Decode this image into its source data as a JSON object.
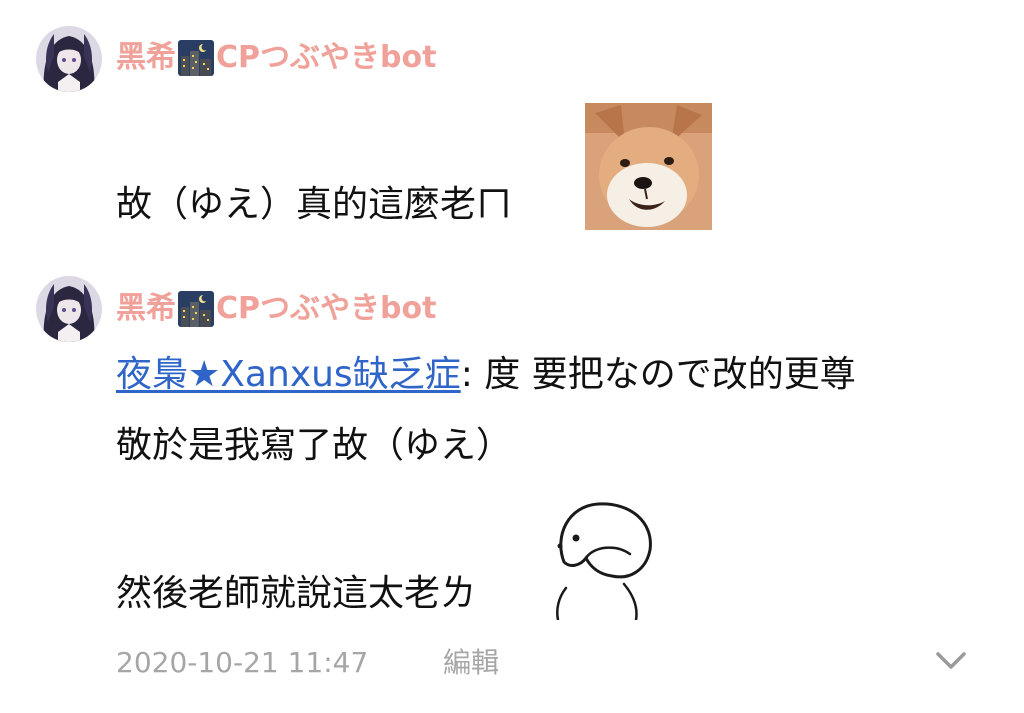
{
  "posts": [
    {
      "author": {
        "name_prefix": "黑希",
        "name_suffix": "CPつぶやきbot",
        "emoji": "night-city-emoji"
      },
      "text": "故（ゆえ）真的這麼老ㄇ",
      "sticker": "shiba-dog-sticker"
    },
    {
      "author": {
        "name_prefix": "黑希",
        "name_suffix": "CPつぶやきbot",
        "emoji": "night-city-emoji"
      },
      "mention": "夜梟★Xanxus缺乏症",
      "line1_rest": ": 度 要把なので改的更尊",
      "line2": "敬於是我寫了故（ゆえ）",
      "line3": "然後老師就說這太老ㄌ",
      "sticker": "doodle-face-sticker"
    }
  ],
  "footer": {
    "timestamp": "2020-10-21 11:47",
    "edit_label": "編輯",
    "expand_icon": "chevron-down-icon"
  },
  "colors": {
    "author": "#f0a29a",
    "mention": "#2f64c8",
    "meta": "#a6a6a6",
    "text": "#111111"
  }
}
